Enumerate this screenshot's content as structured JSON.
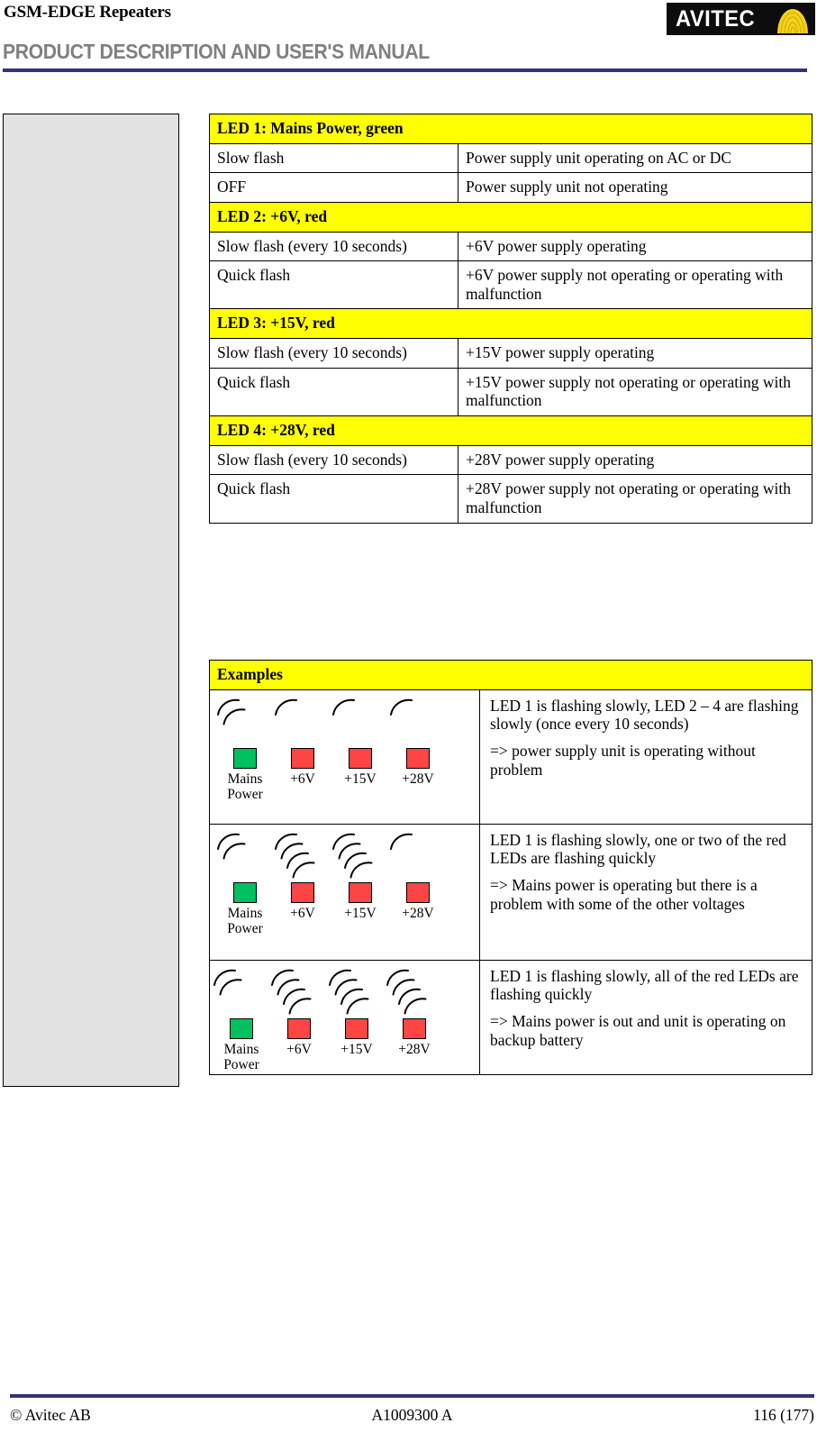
{
  "header": {
    "kicker": "GSM-EDGE Repeaters",
    "title": "PRODUCT DESCRIPTION AND USER'S MANUAL",
    "logo_text": "AVITEC",
    "rule_color": "#333377",
    "title_color": "#808080",
    "logo_bg": "#0d0d0d",
    "logo_mark_color": "#f2d21a"
  },
  "led_table": {
    "sections": [
      {
        "heading": "LED 1: Mains Power, green",
        "rows": [
          {
            "state": "Slow flash",
            "meaning": "Power supply unit operating on AC or DC"
          },
          {
            "state": "OFF",
            "meaning": "Power supply unit not operating"
          }
        ]
      },
      {
        "heading": "LED 2: +6V, red",
        "rows": [
          {
            "state": "Slow flash (every 10 seconds)",
            "meaning": "+6V power supply operating"
          },
          {
            "state": "Quick flash",
            "meaning": "+6V power supply not operating or operating with malfunction"
          }
        ]
      },
      {
        "heading": "LED 3: +15V, red",
        "rows": [
          {
            "state": "Slow flash (every 10 seconds)",
            "meaning": "+15V power supply operating"
          },
          {
            "state": "Quick flash",
            "meaning": "+15V power supply not operating or operating with malfunction"
          }
        ]
      },
      {
        "heading": "LED 4: +28V, red",
        "rows": [
          {
            "state": "Slow flash (every 10 seconds)",
            "meaning": "+28V power supply operating"
          },
          {
            "state": "Quick flash",
            "meaning": "+28V power supply not operating or operating with malfunction"
          }
        ]
      }
    ]
  },
  "examples_table": {
    "heading": "Examples",
    "led_colors": {
      "green": "#00c060",
      "red": "#ff4444"
    },
    "examples": [
      {
        "leds": [
          {
            "label": "Mains Power",
            "color": "green",
            "flash_arcs": 2
          },
          {
            "label": "+6V",
            "color": "red",
            "flash_arcs": 1
          },
          {
            "label": "+15V",
            "color": "red",
            "flash_arcs": 1
          },
          {
            "label": "+28V",
            "color": "red",
            "flash_arcs": 1
          }
        ],
        "line1": "LED 1 is flashing slowly, LED 2 – 4 are flashing slowly (once every 10 seconds)",
        "line2": "=> power supply unit is operating without problem"
      },
      {
        "leds": [
          {
            "label": "Mains Power",
            "color": "green",
            "flash_arcs": 2
          },
          {
            "label": "+6V",
            "color": "red",
            "flash_arcs": 4
          },
          {
            "label": "+15V",
            "color": "red",
            "flash_arcs": 4
          },
          {
            "label": "+28V",
            "color": "red",
            "flash_arcs": 1
          }
        ],
        "line1": "LED 1 is flashing slowly, one or two of the red LEDs are flashing quickly",
        "line2": "=> Mains power is operating but there is a problem with some of the other voltages"
      },
      {
        "leds": [
          {
            "label": "Mains Power",
            "color": "green",
            "flash_arcs": 2
          },
          {
            "label": "+6V",
            "color": "red",
            "flash_arcs": 4
          },
          {
            "label": "+15V",
            "color": "red",
            "flash_arcs": 4
          },
          {
            "label": "+28V",
            "color": "red",
            "flash_arcs": 4
          }
        ],
        "line1": "LED 1 is flashing slowly, all of  the red LEDs are flashing quickly",
        "line2": "=> Mains power is out and unit is operating on backup battery"
      }
    ]
  },
  "footer": {
    "left": "© Avitec AB",
    "center": "A1009300 A",
    "right": "116 (177)"
  }
}
